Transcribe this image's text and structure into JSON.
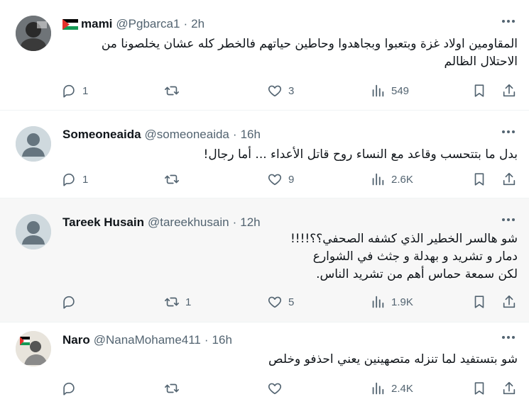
{
  "tweets": [
    {
      "name": "mami",
      "handle": "@Pgbarca1",
      "separator": "·",
      "time": "2h",
      "lines": [
        "المقاومين اولاد غزة وبتعبوا وبجاهدوا وحاطين حياتهم فالخطر كله عشان يخلصونا من",
        "الاحتلال الظالم"
      ],
      "replies": "1",
      "reposts": "",
      "likes": "3",
      "views": "549"
    },
    {
      "name": "Someoneaida",
      "handle": "@someoneaida",
      "separator": "·",
      "time": "16h",
      "lines": [
        "بدل ما بتتحسب وقاعد مع النساء روح قاتل الأعداء ... أما رجال!"
      ],
      "replies": "1",
      "reposts": "",
      "likes": "9",
      "views": "2.6K"
    },
    {
      "name": "Tareek Husain",
      "handle": "@tareekhusain",
      "separator": "·",
      "time": "12h",
      "lines": [
        "شو هالسر الخطير الذي كشفه الصحفي؟؟!!!!",
        "دمار و تشريد و بهدلة و جثث في الشوارع",
        "لكن سمعة حماس أهم من تشريد الناس."
      ],
      "replies": "",
      "reposts": "1",
      "likes": "5",
      "views": "1.9K"
    },
    {
      "name": "Naro",
      "handle": "@NanaMohame411",
      "separator": "·",
      "time": "16h",
      "lines": [
        "شو بتستفيد لما تنزله متصهينين يعني احذفو وخلص"
      ],
      "replies": "",
      "reposts": "",
      "likes": "",
      "views": "2.4K"
    }
  ],
  "colors": {
    "text": "#0f1419",
    "secondary": "#536471",
    "divider": "#eff3f4",
    "hover_background": "#f7f7f7",
    "default_avatar": "#cfd9de"
  },
  "icons": [
    "more-icon",
    "reply-icon",
    "repost-icon",
    "like-icon",
    "views-icon",
    "bookmark-icon",
    "share-icon",
    "palestine-flag-icon"
  ]
}
